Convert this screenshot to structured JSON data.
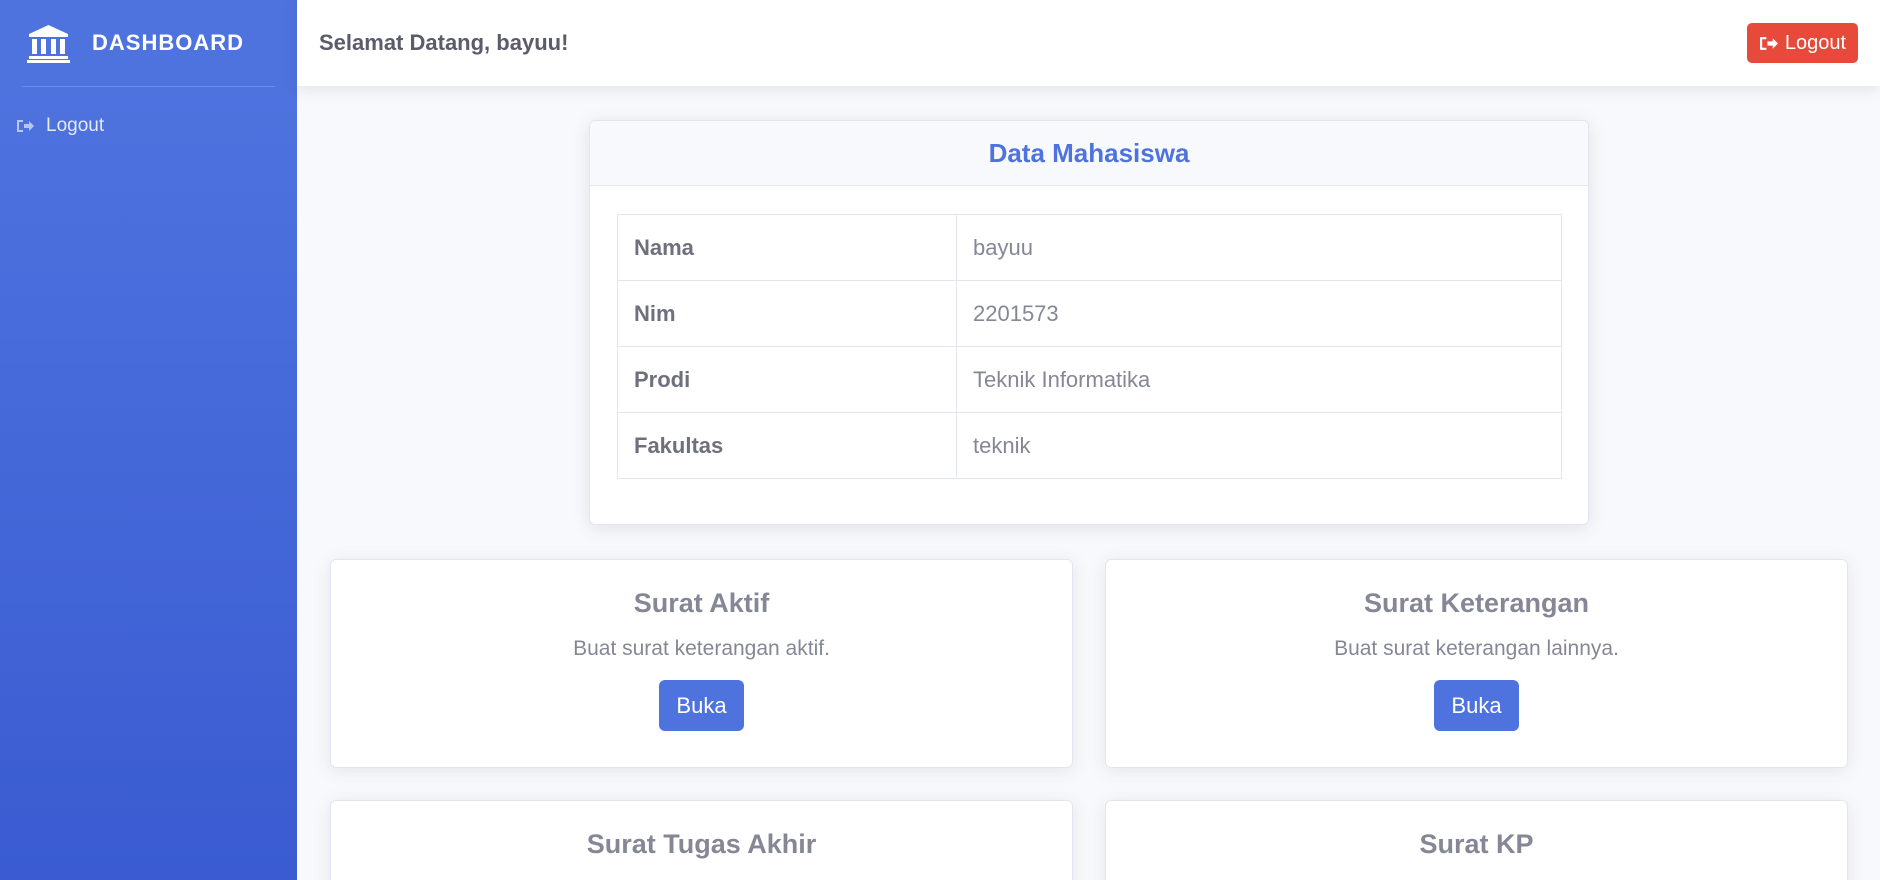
{
  "sidebar": {
    "brand": "DASHBOARD",
    "items": [
      {
        "label": "Logout",
        "icon": "sign-out-icon"
      }
    ]
  },
  "topbar": {
    "welcome": "Selamat Datang, bayuu!",
    "logout_label": "Logout"
  },
  "student": {
    "title": "Data Mahasiswa",
    "rows": [
      {
        "key": "Nama",
        "value": "bayuu"
      },
      {
        "key": "Nim",
        "value": "2201573"
      },
      {
        "key": "Prodi",
        "value": "Teknik Informatika"
      },
      {
        "key": "Fakultas",
        "value": "teknik"
      }
    ]
  },
  "services": [
    {
      "title": "Surat Aktif",
      "desc": "Buat surat keterangan aktif.",
      "button": "Buka"
    },
    {
      "title": "Surat Keterangan",
      "desc": "Buat surat keterangan lainnya.",
      "button": "Buka"
    },
    {
      "title": "Surat Tugas Akhir",
      "desc": "",
      "button": ""
    },
    {
      "title": "Surat KP",
      "desc": "",
      "button": ""
    }
  ],
  "colors": {
    "primary": "#4e73df",
    "danger": "#e74a3b",
    "background": "#f8f9fc"
  }
}
